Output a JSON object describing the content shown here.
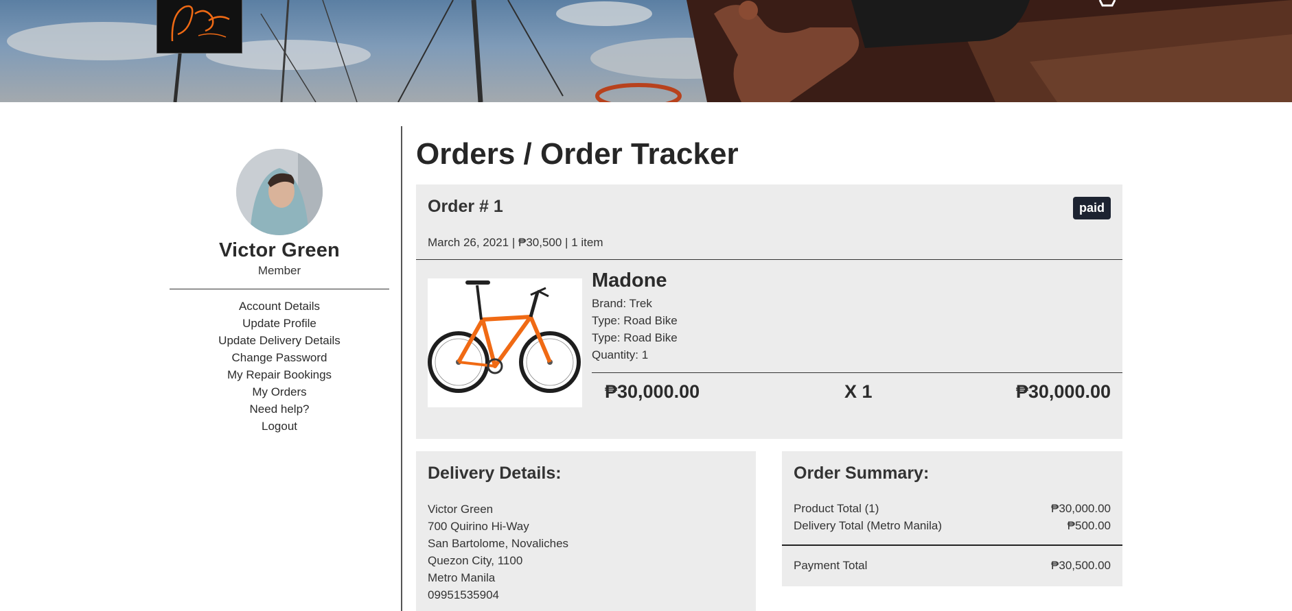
{
  "header": {
    "logo_alt": "Pedal shop logo",
    "cart_icon": "cart-icon"
  },
  "sidebar": {
    "user_name": "Victor Green",
    "user_role": "Member",
    "menu": [
      "Account Details",
      "Update Profile",
      "Update Delivery Details",
      "Change Password",
      "My Repair Bookings",
      "My Orders",
      "Need help?",
      "Logout"
    ]
  },
  "main": {
    "title": "Orders / Order Tracker",
    "order": {
      "number": "Order # 1",
      "status": "paid",
      "meta": "March 26, 2021 | ₱30,500 | 1 item",
      "item": {
        "name": "Madone",
        "brand": "Brand: Trek",
        "type1": "Type: Road Bike",
        "type2": "Type: Road Bike",
        "quantity": "Quantity: 1",
        "unit_price": "₱30,000.00",
        "qty_label": "X 1",
        "line_total": "₱30,000.00"
      }
    },
    "delivery": {
      "title": "Delivery Details:",
      "lines": [
        "Victor Green",
        "700 Quirino Hi-Way",
        "San Bartolome, Novaliches",
        "Quezon City, 1100",
        "Metro Manila",
        "09951535904"
      ]
    },
    "summary": {
      "title": "Order Summary:",
      "product_total_label": "Product Total (1)",
      "product_total_value": "₱30,000.00",
      "delivery_total_label": "Delivery Total (Metro Manila)",
      "delivery_total_value": "₱500.00",
      "payment_total_label": "Payment Total",
      "payment_total_value": "₱30,500.00"
    }
  },
  "colors": {
    "badge_bg": "#1d2331",
    "card_bg": "#ececec",
    "bike_orange": "#f06a14"
  }
}
